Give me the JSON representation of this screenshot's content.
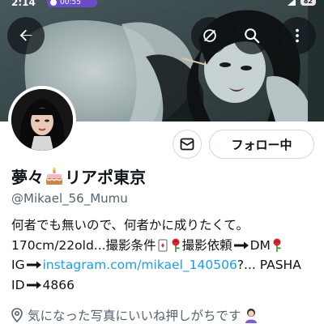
{
  "status_bar": {
    "time": "2:14",
    "media_pill": "00:55",
    "battery": "82"
  },
  "profile": {
    "display_name_part1": "夢々",
    "display_name_part2": "リアポ東京",
    "handle": "@Mikael_56_Mumu",
    "follow_button_label": "フォロー中",
    "bio": {
      "line1": "何者でも無いので、何者かに成りたくて。",
      "line2a": "170cm/22old...撮影条件",
      "line2b": "撮影依頼",
      "line2c": "DM",
      "line3a": "IG",
      "line3_link": "instagram.com/mikael_140506",
      "line3b": "?...  PASHA",
      "line4a": "ID",
      "line4b": "4866"
    },
    "location": "気になった写真にいいね押しがちです"
  },
  "icons": {
    "back": "arrow-left-icon",
    "hide": "eye-slash-icon",
    "search": "search-icon",
    "more": "more-vertical-icon",
    "message": "envelope-icon",
    "location": "map-pin-icon"
  },
  "colors": {
    "link": "#1d9bf0",
    "secondary_text": "#536471",
    "primary_text": "#0f1419",
    "border": "#cfd9de"
  }
}
